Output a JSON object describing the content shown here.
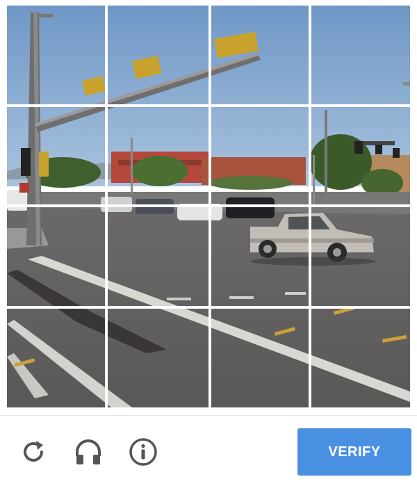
{
  "toolbar": {
    "reload_icon": "reload-icon",
    "audio_icon": "headphones-icon",
    "info_icon": "info-icon",
    "verify_label": "VERIFY"
  },
  "grid": {
    "rows": 4,
    "columns": 4
  },
  "colors": {
    "accent": "#4a90e2",
    "icon": "#555555"
  }
}
